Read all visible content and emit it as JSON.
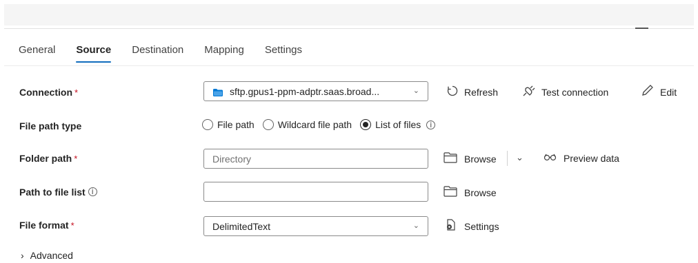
{
  "tabs": [
    {
      "label": "General"
    },
    {
      "label": "Source"
    },
    {
      "label": "Destination"
    },
    {
      "label": "Mapping"
    },
    {
      "label": "Settings"
    }
  ],
  "active_tab": "Source",
  "connection": {
    "label": "Connection",
    "required_mark": "*",
    "value": "sftp.gpus1-ppm-adptr.saas.broad...",
    "refresh_label": "Refresh",
    "test_label": "Test connection",
    "edit_label": "Edit"
  },
  "file_path_type": {
    "label": "File path type",
    "options": [
      "File path",
      "Wildcard file path",
      "List of files"
    ],
    "selected": "List of files",
    "info_glyph": "i"
  },
  "folder_path": {
    "label": "Folder path",
    "required_mark": "*",
    "placeholder": "Directory",
    "browse_label": "Browse",
    "preview_label": "Preview data"
  },
  "path_to_file_list": {
    "label": "Path to file list",
    "info_glyph": "i",
    "value": "",
    "browse_label": "Browse"
  },
  "file_format": {
    "label": "File format",
    "required_mark": "*",
    "value": "DelimitedText",
    "settings_label": "Settings"
  },
  "advanced": {
    "label": "Advanced"
  },
  "colors": {
    "accent": "#0f6cbd",
    "required": "#c50f1f",
    "folder_icon": "#0078d4"
  }
}
